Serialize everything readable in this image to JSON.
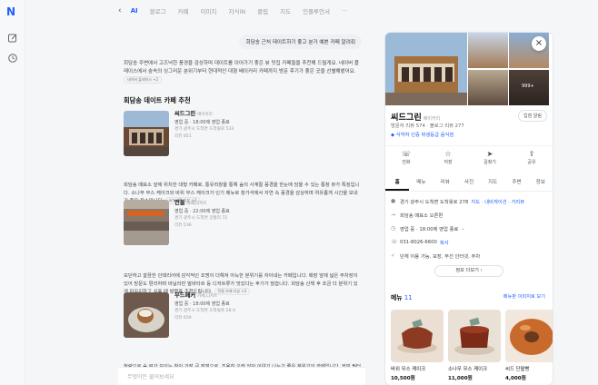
{
  "rail": {
    "logo": "N"
  },
  "nav": {
    "back": "‹",
    "tabs": [
      "AI",
      "블로그",
      "카페",
      "이미지",
      "지식iN",
      "클립",
      "지도",
      "인플루언서"
    ],
    "more": "···"
  },
  "chat": {
    "question": "회담송 근처 데이트하기 좋고 분가 예쁜 카페 알려줘",
    "intro": "회담송 주변에서 고즈넉한 풍경을 감상하며 데이트를 이어가기 좋은 뷰 맛집 카페들을 추천해 드릴게요. 네이버 플레이스에서 숲속의 싱그러운 분위기부터 현대적인 대형 베이커리 카페까지 방문 후기가 좋은 곳을 선별해봤어요.",
    "intro_pill": "네이버 플레이스 +2",
    "section_title": "회담송 데이트 카페 추천",
    "places": [
      {
        "name": "씨드그린",
        "category": "베이커리",
        "hours": "영업 중 · 18:00에 영업 종료",
        "address": "경기 광주시 도척면 도척윗로 533",
        "reviews": "리뷰 851",
        "desc": "회담송 매표소 앞에 위치한 대형 카페로, 통유리창을 통해 숲의 사계절 풍경을 한눈에 담을 수 있는 통창 뷰가 특징입니다. 소나무 무스 케이크와 바위 무스 케이크가 인기 메뉴로 창가석에서 자연 속 풍경을 감상하며 여유롭게 시간을 보내기 좋은 장소입니다.",
        "pill": "씨드그린 리뷰 +2"
      },
      {
        "name": "먼들",
        "category": "카페,디저트",
        "hours": "영업 중 · 22:00에 영업 종료",
        "address": "경기 광주시 도척면 궁평리 72",
        "reviews": "리뷰 536",
        "desc": "모던하고 깔끔한 인테리어에 감각적인 조명이 더해져 아늑한 분위기를 자아내는 카페입니다. 매장 앞에 넓은 주차장이 있어 방문도 편리하며 바닐라빈 말바타르 등 디저트류가 맛있다는 후기가 많습니다. 회담송 산책 후 조금 더 분위기 있게 마무리하고 싶을 때 방문을 추천드립니다.",
        "pill": "먼들 카페 리뷰 +2"
      },
      {
        "name": "무드페커",
        "category": "카페,디저트",
        "hours": "영업 중 · 18:00에 영업 종료",
        "address": "경기 광주시 도척면 도척윗로 28-4",
        "reviews": "리뷰 659",
        "desc": "청량으로 숲 뷰가 보이는 창이 가장 큰 장점으로, 조용히 오래 앉아 이야기 나누기 좋은 분위기의 카페입니다. 커피 필터와 수제 파이, 말차 라떼 루이 보스 바닐라티 메뉴에 리뷰 만족도가 높고, 회담송에서"
      }
    ],
    "ask_placeholder": "무엇이든 물어보세요"
  },
  "panel": {
    "close": "×",
    "photo_more": "999+",
    "name": "씨드그린",
    "category": "베이커리",
    "hope_button": "입점 알림",
    "reviews": "방문자 리뷰 574 · 블로그 리뷰 277",
    "badge": "식약처 인증 위생등급 음식점",
    "actions": [
      {
        "icon": "☏",
        "label": "전화"
      },
      {
        "icon": "☆",
        "label": "저장"
      },
      {
        "icon": "➤",
        "label": "길찾기"
      },
      {
        "icon": "⇪",
        "label": "공유"
      }
    ],
    "tabs": [
      "홈",
      "메뉴",
      "리뷰",
      "사진",
      "지도",
      "주변",
      "정보"
    ],
    "info": {
      "address": "경기 광주시 도척면 도척윗로 278",
      "address_link": "지도 · 내비게이션 · 거리뷰",
      "direction": "회담송 매표소 오른편",
      "hours": "영업 중 · 18:00에 영업 종료",
      "phone": "031-8026-6600",
      "phone_link": "복사",
      "amenities": "단체 이용 가능, 포장, 무선 인터넷, 주차",
      "more_button": "정보 더보기 ›"
    },
    "menu_title": "메뉴",
    "menu_count": "11",
    "menu_link": "메뉴판 이미지로 보기",
    "menus": [
      {
        "name": "바위 무스 케이크",
        "price": "10,500원"
      },
      {
        "name": "소나무 무스 케이크",
        "price": "11,000원"
      },
      {
        "name": "씨드 단팥빵",
        "price": "4,000원"
      }
    ]
  }
}
